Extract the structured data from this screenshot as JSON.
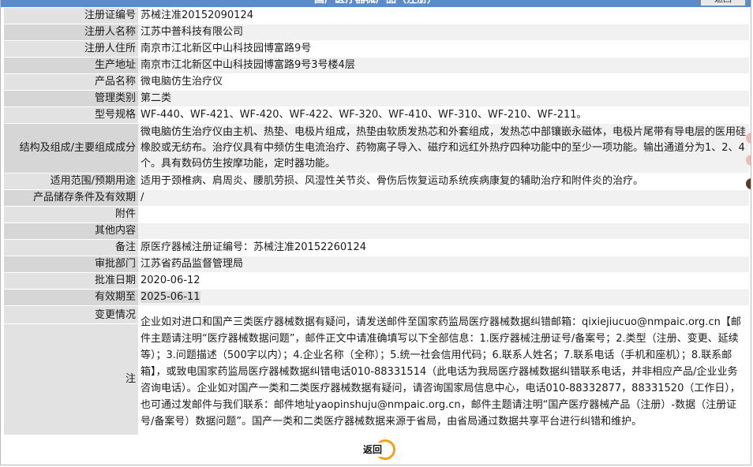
{
  "header": {
    "title": "国产医疗器械产品（注册）",
    "back_label": "返回"
  },
  "rows": [
    {
      "label": "注册证编号",
      "value": "苏械注准20152090124"
    },
    {
      "label": "注册人名称",
      "value": "江苏中普科技有限公司"
    },
    {
      "label": "注册人住所",
      "value": "南京市江北新区中山科技园博富路9号"
    },
    {
      "label": "生产地址",
      "value": "南京市江北新区中山科技园博富路9号3号楼4层"
    },
    {
      "label": "产品名称",
      "value": "微电脑仿生治疗仪"
    },
    {
      "label": "管理类别",
      "value": "第二类"
    },
    {
      "label": "型号规格",
      "value": "WF-440、WF-421、WF-420、WF-422、WF-320、WF-410、WF-310、WF-210、WF-211。"
    },
    {
      "label": "结构及组成/主要组成成分",
      "value": "微电脑仿生治疗仪由主机、热垫、电极片组成，热垫由软质发热芯和外套组成，发热芯中部镶嵌永磁体，电极片尾带有导电层的医用硅橡胶或无纺布。治疗仪具有中频仿生电流治疗、药物离子导入、磁疗和远红外热疗四种功能中的至少一项功能。输出通道分为1、2、4个。具有数码仿生按摩功能，定时器功能。"
    },
    {
      "label": "适用范围/预期用途",
      "value": "适用于颈椎病、肩周炎、腰肌劳损、风湿性关节炎、骨伤后恢复运动系统疾病康复的辅助治疗和附件炎的治疗。"
    },
    {
      "label": "产品储存条件及有效期",
      "value": "/"
    },
    {
      "label": "附件",
      "value": ""
    },
    {
      "label": "其他内容",
      "value": ""
    },
    {
      "label": "备注",
      "value": "原医疗器械注册证编号：苏械注准20152260124"
    },
    {
      "label": "审批部门",
      "value": "江苏省药品监督管理局"
    },
    {
      "label": "批准日期",
      "value": "2020-06-12"
    },
    {
      "label": "有效期至",
      "value": "2025-06-11"
    },
    {
      "label": "变更情况",
      "value": ""
    }
  ],
  "note": {
    "label": "注",
    "text": "企业如对进口和国产三类医疗器械数据有疑问，请发送邮件至国家药监局医疗器械数据纠错邮箱：qixiejiucuo@nmpaic.org.cn【邮件主题请注明“医疗器械数据问题”，邮件正文中请准确填写以下全部信息：1.医疗器械注册证号/备案号；2.类型（注册、变更、延续等）；3.问题描述（500字以内）；4.企业名称（全称）；5.统一社会信用代码；6.联系人姓名；7.联系电话（手机和座机）；8.联系邮箱】，或致电国家药监局医疗器械数据纠错电话010-88331514（此电话为我局医疗器械数据纠错联系电话，并非相应产品/企业业务咨询电话）。企业如对国产一类和二类医疗器械数据有疑问，请咨询国家局信息中心，电话010-88332877，88331520（工作日），也可通过发邮件与我们联系：邮件地址yaopinshuju@nmpaic.org.cn，邮件主题请注明“国产医疗器械产品（注册）-数据（注册证号/备案号）数据问题”。国产一类和二类医疗器械数据来源于省局，由省局通过数据共享平台进行纠错和维护。"
  },
  "footer": {
    "back_label": "返回"
  },
  "colors": {
    "title_bar": "#5a8ccd",
    "label_bg": "#e2e2e2",
    "back_ring": "#f0a21b"
  }
}
